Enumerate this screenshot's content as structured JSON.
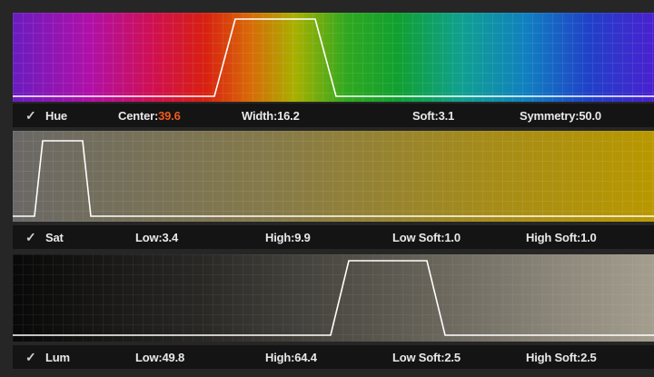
{
  "qualifiers": [
    {
      "id": "hue",
      "enabled": true,
      "label": "Hue",
      "params": [
        {
          "label": "Center:",
          "value": "39.6",
          "accent": true
        },
        {
          "label": "Width:",
          "value": "16.2"
        },
        {
          "label": "Soft:",
          "value": "3.1"
        },
        {
          "label": "Symmetry:",
          "value": "50.0"
        }
      ]
    },
    {
      "id": "sat",
      "enabled": true,
      "label": "Sat",
      "params": [
        {
          "label": "Low:",
          "value": "3.4"
        },
        {
          "label": "High:",
          "value": "9.9"
        },
        {
          "label": "Low Soft:",
          "value": "1.0"
        },
        {
          "label": "High Soft:",
          "value": "1.0"
        }
      ]
    },
    {
      "id": "lum",
      "enabled": true,
      "label": "Lum",
      "params": [
        {
          "label": "Low:",
          "value": "49.8"
        },
        {
          "label": "High:",
          "value": "64.4"
        },
        {
          "label": "Low Soft:",
          "value": "2.5"
        },
        {
          "label": "High Soft:",
          "value": "2.5"
        }
      ]
    }
  ],
  "colors": {
    "accent": "#f05a1e",
    "curve": "#ffffff",
    "bar_bg": "#141414",
    "text": "#e8e8e8"
  },
  "icons": {
    "check": "checkmark-icon"
  }
}
